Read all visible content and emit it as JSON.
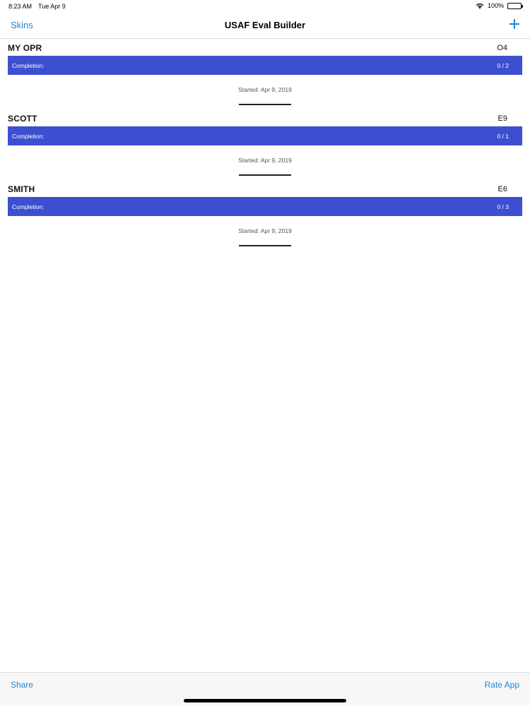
{
  "status_bar": {
    "time": "8:23 AM",
    "date": "Tue Apr 9",
    "battery": "100%"
  },
  "nav": {
    "left_label": "Skins",
    "title": "USAF Eval Builder",
    "add_icon": "plus-icon"
  },
  "evals": [
    {
      "name": "MY OPR",
      "grade": "O4",
      "completion_label": "Completion:",
      "completion_count": "0 / 2",
      "started": "Started: Apr 9, 2019"
    },
    {
      "name": "SCOTT",
      "grade": "E9",
      "completion_label": "Completion:",
      "completion_count": "0 / 1",
      "started": "Started: Apr 9, 2019"
    },
    {
      "name": "SMITH",
      "grade": "E6",
      "completion_label": "Completion:",
      "completion_count": "0 / 3",
      "started": "Started: Apr 9, 2019"
    }
  ],
  "toolbar": {
    "share_label": "Share",
    "rate_label": "Rate App"
  },
  "colors": {
    "accent": "#1a88d6",
    "progress_bar": "#3d4fd1"
  }
}
